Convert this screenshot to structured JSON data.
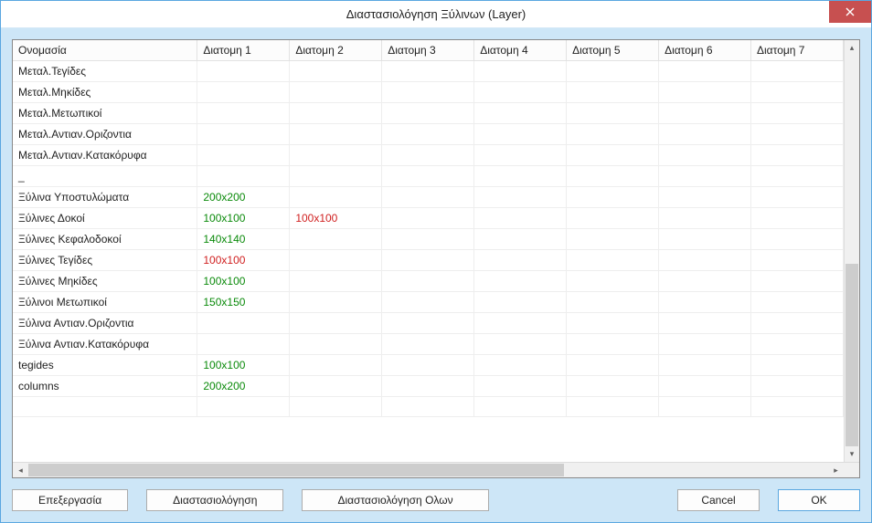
{
  "window": {
    "title": "Διαστασιολόγηση Ξύλινων (Layer)"
  },
  "table": {
    "headers": [
      "Ονομασία",
      "Διατομη 1",
      "Διατομη 2",
      "Διατομη 3",
      "Διατομη 4",
      "Διατομη 5",
      "Διατομη 6",
      "Διατομη 7"
    ],
    "rows": [
      {
        "name": "Μεταλ.Τεγίδες",
        "cells": [
          "",
          "",
          "",
          "",
          "",
          "",
          ""
        ]
      },
      {
        "name": "Μεταλ.Μηκίδες",
        "cells": [
          "",
          "",
          "",
          "",
          "",
          "",
          ""
        ]
      },
      {
        "name": "Μεταλ.Μετωπικοί",
        "cells": [
          "",
          "",
          "",
          "",
          "",
          "",
          ""
        ]
      },
      {
        "name": "Μεταλ.Αντιαν.Οριζοντια",
        "cells": [
          "",
          "",
          "",
          "",
          "",
          "",
          ""
        ]
      },
      {
        "name": "Μεταλ.Αντιαν.Κατακόρυφα",
        "cells": [
          "",
          "",
          "",
          "",
          "",
          "",
          ""
        ]
      },
      {
        "name": "_",
        "cells": [
          "",
          "",
          "",
          "",
          "",
          "",
          ""
        ]
      },
      {
        "name": "Ξύλινα Υποστυλώματα",
        "cells": [
          {
            "v": "200x200",
            "c": "green"
          },
          "",
          "",
          "",
          "",
          "",
          ""
        ]
      },
      {
        "name": "Ξύλινες Δοκοί",
        "cells": [
          {
            "v": "100x100",
            "c": "green"
          },
          {
            "v": "100x100",
            "c": "red"
          },
          "",
          "",
          "",
          "",
          ""
        ]
      },
      {
        "name": "Ξύλινες Κεφαλοδοκοί",
        "cells": [
          {
            "v": "140x140",
            "c": "green"
          },
          "",
          "",
          "",
          "",
          "",
          ""
        ]
      },
      {
        "name": "Ξύλινες Τεγίδες",
        "cells": [
          {
            "v": "100x100",
            "c": "red"
          },
          "",
          "",
          "",
          "",
          "",
          ""
        ]
      },
      {
        "name": "Ξύλινες Μηκίδες",
        "cells": [
          {
            "v": "100x100",
            "c": "green"
          },
          "",
          "",
          "",
          "",
          "",
          ""
        ]
      },
      {
        "name": "Ξύλινοι Μετωπικοί",
        "cells": [
          {
            "v": "150x150",
            "c": "green"
          },
          "",
          "",
          "",
          "",
          "",
          ""
        ]
      },
      {
        "name": "Ξύλινα Αντιαν.Οριζοντια",
        "cells": [
          "",
          "",
          "",
          "",
          "",
          "",
          ""
        ]
      },
      {
        "name": "Ξύλινα Αντιαν.Κατακόρυφα",
        "cells": [
          "",
          "",
          "",
          "",
          "",
          "",
          ""
        ]
      },
      {
        "name": "tegides",
        "cells": [
          {
            "v": "100x100",
            "c": "green"
          },
          "",
          "",
          "",
          "",
          "",
          ""
        ]
      },
      {
        "name": "columns",
        "cells": [
          {
            "v": "200x200",
            "c": "green"
          },
          "",
          "",
          "",
          "",
          "",
          ""
        ]
      },
      {
        "name": "",
        "cells": [
          "",
          "",
          "",
          "",
          "",
          "",
          ""
        ]
      }
    ]
  },
  "buttons": {
    "edit": "Επεξεργασία",
    "dimension": "Διαστασιολόγηση",
    "dimension_all": "Διαστασιολόγηση Ολων",
    "cancel": "Cancel",
    "ok": "OK"
  }
}
